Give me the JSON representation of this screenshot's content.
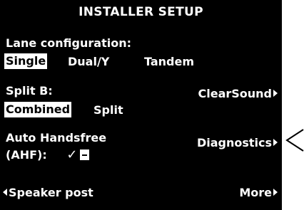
{
  "screen": {
    "title": "INSTALLER SETUP",
    "lane_configuration": {
      "label": "Lane configuration:",
      "options": [
        "Single",
        "Dual/Y",
        "Tandem"
      ],
      "selected": "Single"
    },
    "split_b": {
      "label": "Split B:",
      "options": [
        "Combined",
        "Split"
      ],
      "selected": "Combined"
    },
    "auto_handsfree": {
      "label_line1": "Auto Handsfree",
      "label_line2": "(AHF):",
      "check_symbol": "✓",
      "minus_box_icon": "minus-box-icon"
    },
    "right_menu": {
      "clearsound": "ClearSound",
      "diagnostics": "Diagnostics",
      "more": "More"
    },
    "bottom_left": "Speaker post"
  },
  "colors": {
    "screen_background": "#000000",
    "screen_text": "#ffffff",
    "page_background": "#ffffff"
  }
}
